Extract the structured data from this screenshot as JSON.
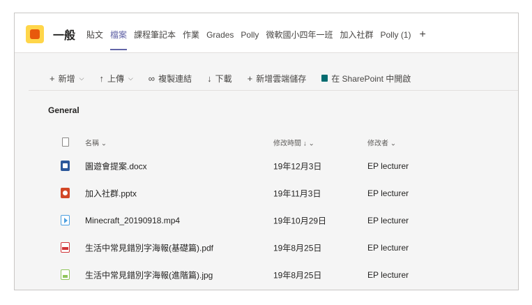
{
  "channel": {
    "title": "一般"
  },
  "tabs": [
    {
      "label": "貼文",
      "active": false
    },
    {
      "label": "檔案",
      "active": true
    },
    {
      "label": "課程筆記本",
      "active": false
    },
    {
      "label": "作業",
      "active": false
    },
    {
      "label": "Grades",
      "active": false
    },
    {
      "label": "Polly",
      "active": false
    },
    {
      "label": "微軟國小四年一班",
      "active": false
    },
    {
      "label": "加入社群",
      "active": false
    },
    {
      "label": "Polly (1)",
      "active": false
    }
  ],
  "tab_add_icon": "+",
  "toolbar": {
    "new": {
      "label": "新增",
      "icon": "plus-icon"
    },
    "upload": {
      "label": "上傳",
      "icon": "upload-icon"
    },
    "copy_link": {
      "label": "複製連結",
      "icon": "link-icon"
    },
    "download": {
      "label": "下載",
      "icon": "download-icon"
    },
    "add_cloud": {
      "label": "新增雲端儲存",
      "icon": "plus-icon"
    },
    "open_sharepoint": {
      "label": "在 SharePoint 中開啟",
      "icon": "sharepoint-icon"
    }
  },
  "section": {
    "title": "General"
  },
  "table": {
    "headers": {
      "name": "名稱",
      "modified": "修改時間",
      "modified_by": "修改者"
    },
    "rows": [
      {
        "type": "word",
        "name": "園遊會提案.docx",
        "modified": "19年12月3日",
        "modified_by": "EP lecturer"
      },
      {
        "type": "ppt",
        "name": "加入社群.pptx",
        "modified": "19年11月3日",
        "modified_by": "EP lecturer"
      },
      {
        "type": "video",
        "name": "Minecraft_20190918.mp4",
        "modified": "19年10月29日",
        "modified_by": "EP lecturer"
      },
      {
        "type": "pdf",
        "name": "生活中常見錯別字海報(基礎篇).pdf",
        "modified": "19年8月25日",
        "modified_by": "EP lecturer"
      },
      {
        "type": "img",
        "name": "生活中常見錯別字海報(進階篇).jpg",
        "modified": "19年8月25日",
        "modified_by": "EP lecturer"
      }
    ]
  },
  "colors": {
    "accent": "#6264a7",
    "team_icon_bg": "#ffd64a",
    "team_icon_fg": "#e8590c"
  }
}
